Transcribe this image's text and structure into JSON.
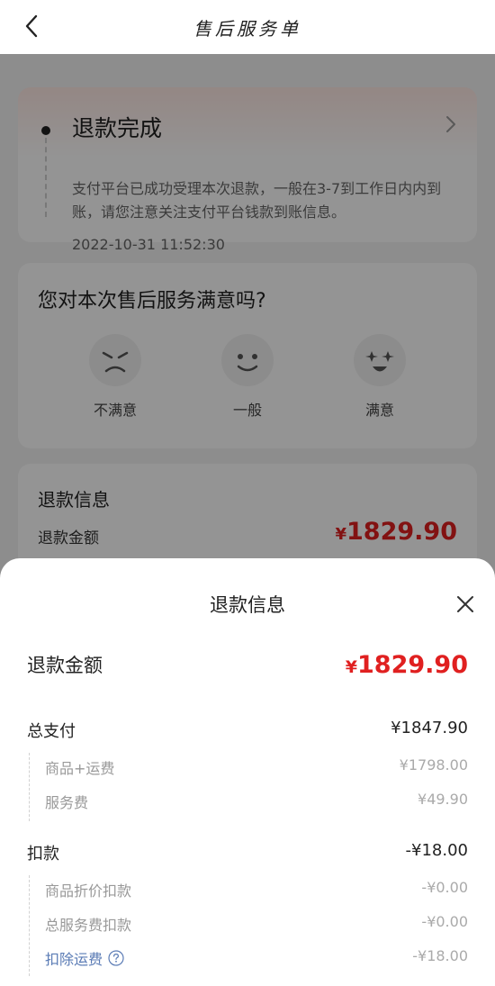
{
  "header": {
    "title": "售后服务单"
  },
  "status": {
    "title": "退款完成",
    "description": "支付平台已成功受理本次退款，一般在3-7到工作日内内到账，请您注意关注支付平台钱款到账信息。",
    "time": "2022-10-31 11:52:30"
  },
  "survey": {
    "question": "您对本次售后服务满意吗?",
    "options": [
      {
        "label": "不满意",
        "icon": "angry-face-icon"
      },
      {
        "label": "一般",
        "icon": "smile-face-icon"
      },
      {
        "label": "满意",
        "icon": "happy-star-face-icon"
      }
    ]
  },
  "refund_card": {
    "title": "退款信息",
    "amount_label": "退款金额",
    "currency": "¥",
    "amount": "1829.90"
  },
  "sheet": {
    "title": "退款信息",
    "refund_label": "退款金额",
    "currency": "¥",
    "refund_amount": "1829.90",
    "total_paid": {
      "label": "总支付",
      "value": "¥1847.90",
      "items": [
        {
          "label": "商品+运费",
          "value": "¥1798.00"
        },
        {
          "label": "服务费",
          "value": "¥49.90"
        }
      ]
    },
    "deduction": {
      "label": "扣款",
      "value": "-¥18.00",
      "items": [
        {
          "label": "商品折价扣款",
          "value": "-¥0.00"
        },
        {
          "label": "总服务费扣款",
          "value": "-¥0.00"
        },
        {
          "label": "扣除运费",
          "value": "-¥18.00"
        }
      ]
    }
  },
  "colors": {
    "accent": "#e02020",
    "link": "#5a7bb5"
  }
}
